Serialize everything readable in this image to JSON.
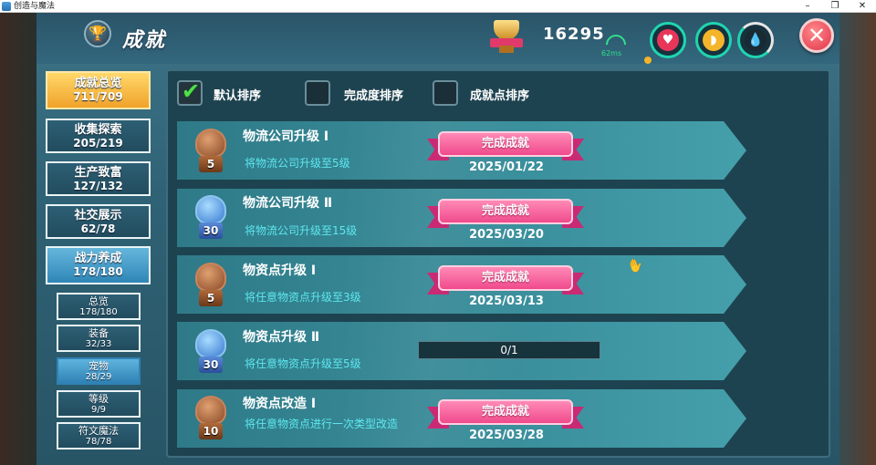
{
  "window": {
    "title": "创造与魔法"
  },
  "header": {
    "title": "成就",
    "points": "16295",
    "ping": "62ms",
    "close_glyph": "✕",
    "icons": [
      "trophy-icon",
      "gold-cup-icon",
      "wifi-icon",
      "heart-icon",
      "food-icon",
      "water-drop-icon",
      "close-icon"
    ]
  },
  "sidebar": {
    "categories": [
      {
        "label": "成就总览",
        "count": "711/709"
      },
      {
        "label": "收集探索",
        "count": "205/219"
      },
      {
        "label": "生产致富",
        "count": "127/132"
      },
      {
        "label": "社交展示",
        "count": "62/78"
      },
      {
        "label": "战力养成",
        "count": "178/180"
      }
    ],
    "subcategories": [
      {
        "label": "总览",
        "count": "178/180"
      },
      {
        "label": "装备",
        "count": "32/33"
      },
      {
        "label": "宠物",
        "count": "28/29"
      },
      {
        "label": "等级",
        "count": "9/9"
      },
      {
        "label": "符文魔法",
        "count": "78/78"
      }
    ]
  },
  "sort": {
    "default": "默认排序",
    "completion": "完成度排序",
    "points": "成就点排序"
  },
  "achievements": [
    {
      "name": "物流公司升级 Ⅰ",
      "desc": "将物流公司升级至5级",
      "level": "5",
      "tier": "bronze",
      "status": "完成成就",
      "date": "2025/01/22"
    },
    {
      "name": "物流公司升级 Ⅱ",
      "desc": "将物流公司升级至15级",
      "level": "30",
      "tier": "blue",
      "status": "完成成就",
      "date": "2025/03/20"
    },
    {
      "name": "物资点升级 Ⅰ",
      "desc": "将任意物资点升级至3级",
      "level": "5",
      "tier": "bronze",
      "status": "完成成就",
      "date": "2025/03/13"
    },
    {
      "name": "物资点升级 Ⅱ",
      "desc": "将任意物资点升级至5级",
      "level": "30",
      "tier": "blue",
      "progress_text": "0/1",
      "progress": 0
    },
    {
      "name": "物资点改造 Ⅰ",
      "desc": "将任意物资点进行一次类型改造",
      "level": "10",
      "tier": "bronze",
      "status": "完成成就",
      "date": "2025/03/28"
    }
  ],
  "colors": {
    "active_tab": "#f0a22a",
    "selected_tab": "#2e86b7",
    "banner": "#f04a8c",
    "desc_text": "#5ee8ee"
  }
}
